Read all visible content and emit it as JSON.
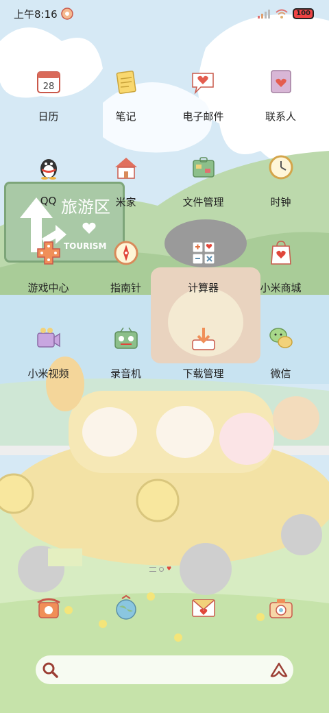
{
  "status_bar": {
    "time": "上午8:16",
    "battery": "100",
    "icons": [
      "notification-icon",
      "signal-icon",
      "wifi-icon",
      "battery-icon"
    ]
  },
  "wallpaper": {
    "sign_text_cn": "旅游区",
    "sign_text_en": "TOURISM"
  },
  "apps": [
    {
      "label": "日历",
      "icon": "calendar-icon",
      "badge": "28"
    },
    {
      "label": "笔记",
      "icon": "notes-icon"
    },
    {
      "label": "电子邮件",
      "icon": "email-icon"
    },
    {
      "label": "联系人",
      "icon": "contacts-icon"
    },
    {
      "label": "QQ",
      "icon": "qq-penguin-icon"
    },
    {
      "label": "米家",
      "icon": "mi-home-icon"
    },
    {
      "label": "文件管理",
      "icon": "file-manager-icon"
    },
    {
      "label": "时钟",
      "icon": "clock-icon"
    },
    {
      "label": "游戏中心",
      "icon": "game-center-icon"
    },
    {
      "label": "指南针",
      "icon": "compass-icon"
    },
    {
      "label": "计算器",
      "icon": "calculator-icon"
    },
    {
      "label": "小米商城",
      "icon": "mi-store-icon"
    },
    {
      "label": "小米视频",
      "icon": "mi-video-icon"
    },
    {
      "label": "录音机",
      "icon": "recorder-icon"
    },
    {
      "label": "下载管理",
      "icon": "download-icon"
    },
    {
      "label": "微信",
      "icon": "wechat-icon"
    }
  ],
  "dock": [
    {
      "icon": "phone-icon"
    },
    {
      "icon": "browser-globe-icon"
    },
    {
      "icon": "messages-icon"
    },
    {
      "icon": "camera-icon"
    }
  ],
  "search_bar": {
    "left_icon": "search-icon",
    "right_icon": "assistant-icon"
  },
  "colors": {
    "sky": "#cfe6f4",
    "hill": "#b8d6a6",
    "car": "#f4e3a6",
    "accent": "#c9584a"
  }
}
